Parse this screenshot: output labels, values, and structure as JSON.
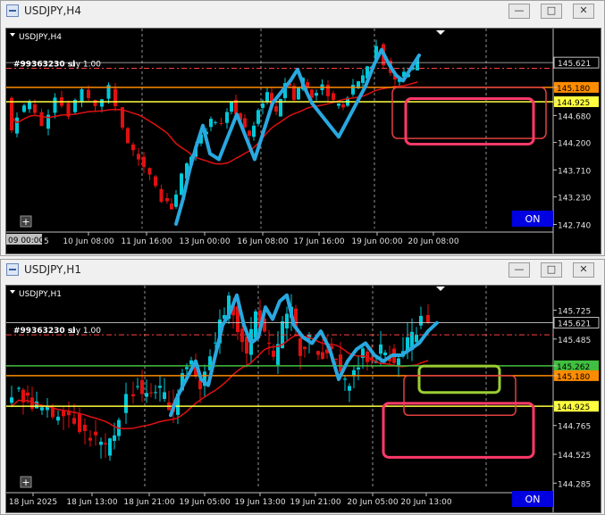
{
  "windows": [
    {
      "title": "USDJPY,H4",
      "symbol_label": "USDJPY,H4",
      "order_label": "#99363230 sl",
      "order_label2": "uy 1.00",
      "on_label": "ON",
      "corner_label": "09 00:00",
      "corner_label2": "5",
      "chart_data": {
        "type": "candlestick",
        "title": "USDJPY,H4",
        "y_ticks": [
          "145.621",
          "145.180",
          "144.925",
          "144.680",
          "144.200",
          "143.710",
          "143.230",
          "142.740"
        ],
        "x_ticks": [
          "10 Jun 08:00",
          "11 Jun 16:00",
          "13 Jun 00:00",
          "16 Jun 08:00",
          "17 Jun 16:00",
          "19 Jun 00:00",
          "20 Jun 08:00"
        ],
        "ylim": [
          142.7,
          146.1
        ],
        "current_price": 145.621,
        "levels": [
          {
            "value": 145.52,
            "color": "#ff4040",
            "style": "dash-dot"
          },
          {
            "value": 145.18,
            "color": "#ff8c00",
            "label": "145.180"
          },
          {
            "value": 144.925,
            "color": "#ffff40",
            "label": "144.925"
          }
        ]
      }
    },
    {
      "title": "USDJPY,H1",
      "symbol_label": "USDJPY,H1",
      "order_label": "#99363230 sl",
      "order_label2": "uy 1.00",
      "on_label": "ON",
      "chart_data": {
        "type": "candlestick",
        "title": "USDJPY,H1",
        "y_ticks": [
          "145.725",
          "145.621",
          "145.485",
          "145.262",
          "145.180",
          "144.925",
          "144.765",
          "144.525",
          "144.285"
        ],
        "x_ticks": [
          "18 Jun 2025",
          "18 Jun 13:00",
          "18 Jun 21:00",
          "19 Jun 05:00",
          "19 Jun 13:00",
          "19 Jun 21:00",
          "20 Jun 05:00",
          "20 Jun 13:00"
        ],
        "ylim": [
          144.25,
          145.9
        ],
        "current_price": 145.621,
        "levels": [
          {
            "value": 145.52,
            "color": "#ff4040",
            "style": "dash-dot"
          },
          {
            "value": 145.262,
            "color": "#40c040",
            "label": "145.262"
          },
          {
            "value": 145.18,
            "color": "#ff8c00",
            "label": "145.180"
          },
          {
            "value": 144.925,
            "color": "#ffff40",
            "label": "144.925"
          }
        ]
      }
    }
  ],
  "colors": {
    "bull": "#00c8d8",
    "bear": "#e01010",
    "ma": "#e01010",
    "drawing": "#29a8e0"
  }
}
